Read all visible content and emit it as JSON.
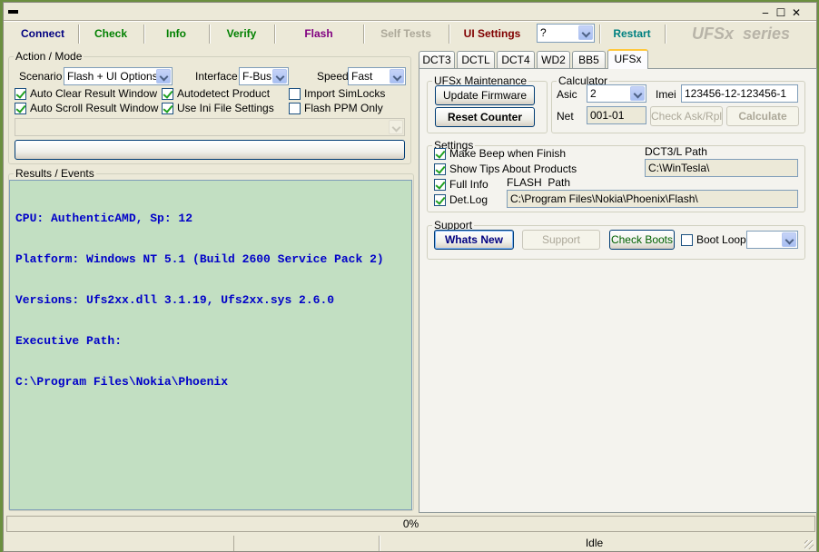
{
  "window": {
    "controls": {
      "minimize": "‒",
      "maximize": "☐",
      "close": "✕"
    }
  },
  "toolbar": {
    "connect": "Connect",
    "check": "Check",
    "info": "Info",
    "verify": "Verify",
    "flash": "Flash",
    "self_tests": "Self Tests",
    "ui_settings": "UI Settings",
    "question_select": "?",
    "restart": "Restart",
    "brand": "UFSx  series"
  },
  "colors": {
    "connect": "#000080",
    "check": "#008000",
    "info": "#008000",
    "verify": "#008000",
    "flash": "#800080",
    "self_tests": "#aca899",
    "ui_settings": "#800000",
    "restart": "#008080",
    "brand": "#b8b4a8",
    "results_bg": "#c2dfc2",
    "results_text": "#0000c8"
  },
  "action_mode": {
    "legend": "Action / Mode",
    "scenario_label": "Scenario",
    "scenario_value": "Flash + UI Options",
    "interface_label": "Interface",
    "interface_value": "F-Bus",
    "speed_label": "Speed",
    "speed_value": "Fast",
    "checkboxes": [
      {
        "label": "Auto Clear Result Window",
        "checked": true
      },
      {
        "label": "Autodetect Product",
        "checked": true
      },
      {
        "label": "Import SimLocks",
        "checked": false
      },
      {
        "label": "Auto Scroll Result Window",
        "checked": true
      },
      {
        "label": "Use Ini File Settings",
        "checked": true
      },
      {
        "label": "Flash PPM Only",
        "checked": false
      }
    ]
  },
  "results": {
    "legend": "Results / Events",
    "lines": [
      "CPU: AuthenticAMD, Sp: 12",
      "Platform: Windows NT 5.1 (Build 2600 Service Pack 2)",
      "Versions: Ufs2xx.dll 3.1.19, Ufs2xx.sys 2.6.0",
      "Executive Path:",
      "C:\\Program Files\\Nokia\\Phoenix"
    ]
  },
  "tabs": [
    "DCT3",
    "DCTL",
    "DCT4",
    "WD2",
    "BB5",
    "UFSx"
  ],
  "active_tab": "UFSx",
  "ufsx": {
    "maintenance": {
      "legend": "UFSx Maintenance",
      "update_firmware": "Update Firmware",
      "reset_counter": "Reset Counter"
    },
    "calculator": {
      "legend": "Calculator",
      "asic_label": "Asic",
      "asic_value": "2",
      "imei_label": "Imei",
      "imei_value": "123456-12-123456-1",
      "net_label": "Net",
      "net_value": "001-01",
      "check_ask": "Check Ask/Rpl",
      "calculate": "Calculate"
    },
    "settings": {
      "legend": "Settings",
      "checkboxes": [
        {
          "label": "Make Beep when Finish",
          "checked": true
        },
        {
          "label": "Show Tips About Products",
          "checked": true
        },
        {
          "label": "Full Info",
          "checked": true
        },
        {
          "label": "Det.Log",
          "checked": true
        }
      ],
      "dct3_path_label": "DCT3/L Path",
      "dct3_path_value": "C:\\WinTesla\\",
      "flash_path_label": "FLASH  Path",
      "flash_path_value": "C:\\Program Files\\Nokia\\Phoenix\\Flash\\"
    },
    "support": {
      "legend": "Support",
      "whats_new": "Whats New",
      "support_btn": "Support",
      "check_boots": "Check Boots",
      "boot_loop_label": "Boot Loop",
      "boot_loop_checked": false
    }
  },
  "progress": {
    "text": "0%",
    "value": 0
  },
  "status": {
    "state": "Idle"
  }
}
